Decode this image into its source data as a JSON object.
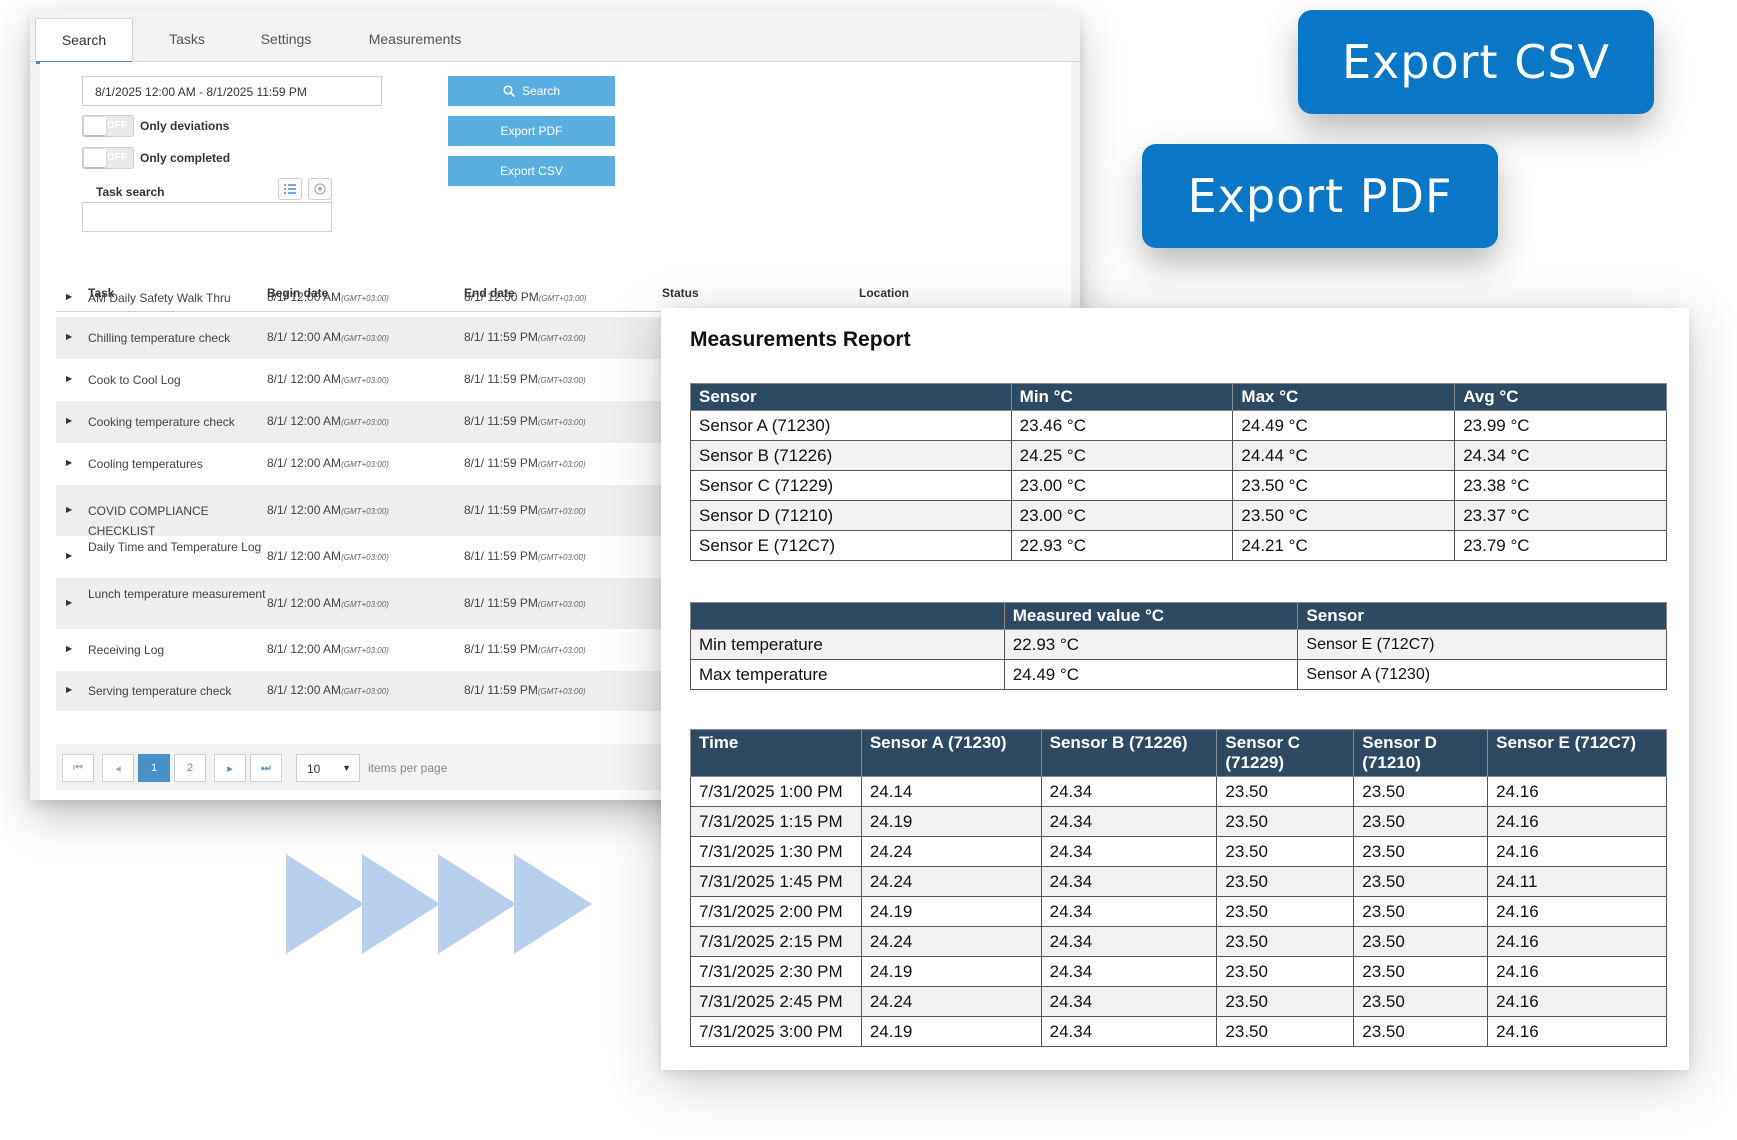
{
  "tabs": [
    "Search",
    "Tasks",
    "Settings",
    "Measurements"
  ],
  "search_panel": {
    "date_range": "8/1/2025 12:00 AM - 8/1/2025 11:59 PM",
    "toggle_off_text": "OFF",
    "only_deviations_label": "Only deviations",
    "only_completed_label": "Only completed",
    "task_search_label": "Task search",
    "search_button": "Search",
    "export_pdf_button": "Export PDF",
    "export_csv_button": "Export CSV"
  },
  "task_table": {
    "headers": [
      "Task",
      "Begin date",
      "End date",
      "Status",
      "Location"
    ],
    "timezone": "(GMT+03:00)",
    "rows": [
      {
        "task": "AM Daily Safety Walk Thru",
        "begin": "8/1/ 12:00 AM",
        "end": "8/1/ 12:00 PM"
      },
      {
        "task": "Chilling temperature check",
        "begin": "8/1/ 12:00 AM",
        "end": "8/1/ 11:59 PM"
      },
      {
        "task": "Cook to Cool Log",
        "begin": "8/1/ 12:00 AM",
        "end": "8/1/ 11:59 PM"
      },
      {
        "task": "Cooking temperature check",
        "begin": "8/1/ 12:00 AM",
        "end": "8/1/ 11:59 PM"
      },
      {
        "task": "Cooling temperatures",
        "begin": "8/1/ 12:00 AM",
        "end": "8/1/ 11:59 PM"
      },
      {
        "task": "COVID COMPLIANCE CHECKLIST",
        "begin": "8/1/ 12:00 AM",
        "end": "8/1/ 11:59 PM"
      },
      {
        "task": "Daily Time and Temperature Log",
        "begin": "8/1/ 12:00 AM",
        "end": "8/1/ 11:59 PM"
      },
      {
        "task": "Lunch temperature measurement",
        "begin": "8/1/ 12:00 AM",
        "end": "8/1/ 11:59 PM"
      },
      {
        "task": "Receiving Log",
        "begin": "8/1/ 12:00 AM",
        "end": "8/1/ 11:59 PM"
      },
      {
        "task": "Serving temperature check",
        "begin": "8/1/ 12:00 AM",
        "end": "8/1/ 11:59 PM"
      }
    ]
  },
  "pagination": {
    "first": "⏮",
    "prev": "◂",
    "pages": [
      "1",
      "2"
    ],
    "current_page": "1",
    "next": "▸",
    "last": "⏭",
    "per_page_value": "10",
    "per_page_label": "items per page"
  },
  "export_csv_big": "Export CSV",
  "export_pdf_big": "Export PDF",
  "accent_colors": {
    "primary_blue": "#0a76c6",
    "light_blue": "#5aaee0",
    "arrow_blue": "#b8d0ee",
    "table_header": "#2e4a62"
  },
  "report": {
    "title": "Measurements Report",
    "summary": {
      "headers": [
        "Sensor",
        "Min °C",
        "Max °C",
        "Avg °C"
      ],
      "rows": [
        [
          "Sensor A (71230)",
          "23.46 °C",
          "24.49 °C",
          "23.99 °C"
        ],
        [
          "Sensor B (71226)",
          "24.25 °C",
          "24.44 °C",
          "24.34 °C"
        ],
        [
          "Sensor C (71229)",
          "23.00 °C",
          "23.50 °C",
          "23.38 °C"
        ],
        [
          "Sensor D (71210)",
          "23.00 °C",
          "23.50 °C",
          "23.37 °C"
        ],
        [
          "Sensor E (712C7)",
          "22.93 °C",
          "24.21 °C",
          "23.79 °C"
        ]
      ]
    },
    "extremes": {
      "headers": [
        "",
        "Measured value °C",
        "Sensor"
      ],
      "rows": [
        [
          "Min temperature",
          "22.93 °C",
          "Sensor E (712C7)"
        ],
        [
          "Max temperature",
          "24.49 °C",
          "Sensor A (71230)"
        ]
      ]
    },
    "readings": {
      "headers": [
        "Time",
        "Sensor A (71230)",
        "Sensor B (71226)",
        "Sensor C (71229)",
        "Sensor D (71210)",
        "Sensor E (712C7)"
      ],
      "rows": [
        [
          "7/31/2025 1:00 PM",
          "24.14",
          "24.34",
          "23.50",
          "23.50",
          "24.16"
        ],
        [
          "7/31/2025 1:15 PM",
          "24.19",
          "24.34",
          "23.50",
          "23.50",
          "24.16"
        ],
        [
          "7/31/2025 1:30 PM",
          "24.24",
          "24.34",
          "23.50",
          "23.50",
          "24.16"
        ],
        [
          "7/31/2025 1:45 PM",
          "24.24",
          "24.34",
          "23.50",
          "23.50",
          "24.11"
        ],
        [
          "7/31/2025 2:00 PM",
          "24.19",
          "24.34",
          "23.50",
          "23.50",
          "24.16"
        ],
        [
          "7/31/2025 2:15 PM",
          "24.24",
          "24.34",
          "23.50",
          "23.50",
          "24.16"
        ],
        [
          "7/31/2025 2:30 PM",
          "24.19",
          "24.34",
          "23.50",
          "23.50",
          "24.16"
        ],
        [
          "7/31/2025 2:45 PM",
          "24.24",
          "24.34",
          "23.50",
          "23.50",
          "24.16"
        ],
        [
          "7/31/2025 3:00 PM",
          "24.19",
          "24.34",
          "23.50",
          "23.50",
          "24.16"
        ]
      ]
    }
  }
}
